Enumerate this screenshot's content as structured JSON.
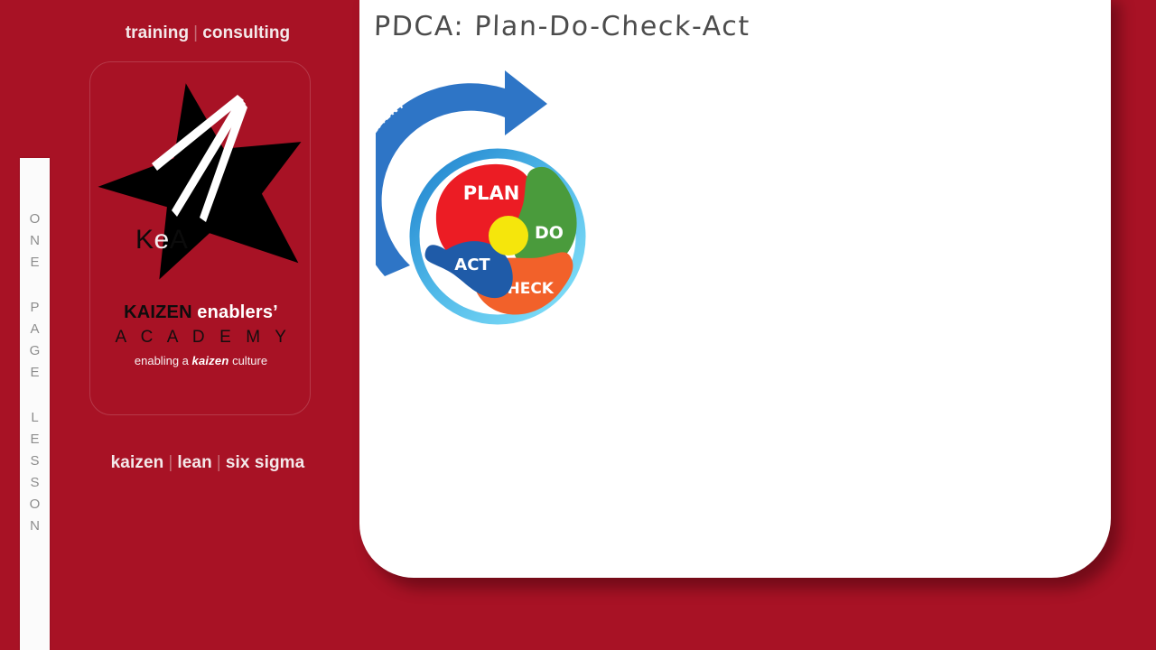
{
  "slide": {
    "background_color": "#a81225",
    "title": "PDCA: Plan-Do-Check-Act"
  },
  "side_strip": {
    "label": "ONE PAGE LESSON",
    "words": [
      "ONE",
      "PAGE",
      "LESSON"
    ],
    "text_color": "#8d8d8d",
    "background_color": "#fbfbfb"
  },
  "brand": {
    "tagline_top": {
      "items": [
        "training",
        "consulting"
      ],
      "separator": "|"
    },
    "tagline_bottom": {
      "items": [
        "kaizen",
        "lean",
        "six sigma"
      ],
      "separator": "|"
    },
    "logo": {
      "mark_text_k": "K",
      "mark_text_e": "e",
      "mark_text_a": "A",
      "mark_alt": "black five-point star with white motion streaks",
      "name_bold_dark": "KAIZEN",
      "name_bold_white": "enablers’",
      "subtitle": "A C A D E M Y",
      "strapline_prefix": "enabling  a ",
      "strapline_emphasis": "kaizen",
      "strapline_suffix": " culture",
      "star_color": "#000000",
      "streak_color": "#ffffff"
    }
  },
  "content_card": {
    "background_color": "#ffffff",
    "title_color": "#4c4c4c"
  },
  "pdca_diagram": {
    "alt": "PDCA continual improvement wheel",
    "arrow_label": "CONTINUAL IMPROVEMENT",
    "arrow_color": "#2e75c6",
    "center_color": "#f5e60c",
    "ring_color_start": "#2b8fd4",
    "ring_color_end": "#6fd4f5",
    "segments": [
      {
        "label": "PLAN",
        "color": "#ec1c24",
        "position": "top-left"
      },
      {
        "label": "DO",
        "color": "#4a9b3c",
        "position": "top-right"
      },
      {
        "label": "CHECK",
        "color": "#f2612a",
        "position": "bottom-right"
      },
      {
        "label": "ACT",
        "color": "#1f5ba8",
        "position": "bottom-left"
      }
    ]
  }
}
